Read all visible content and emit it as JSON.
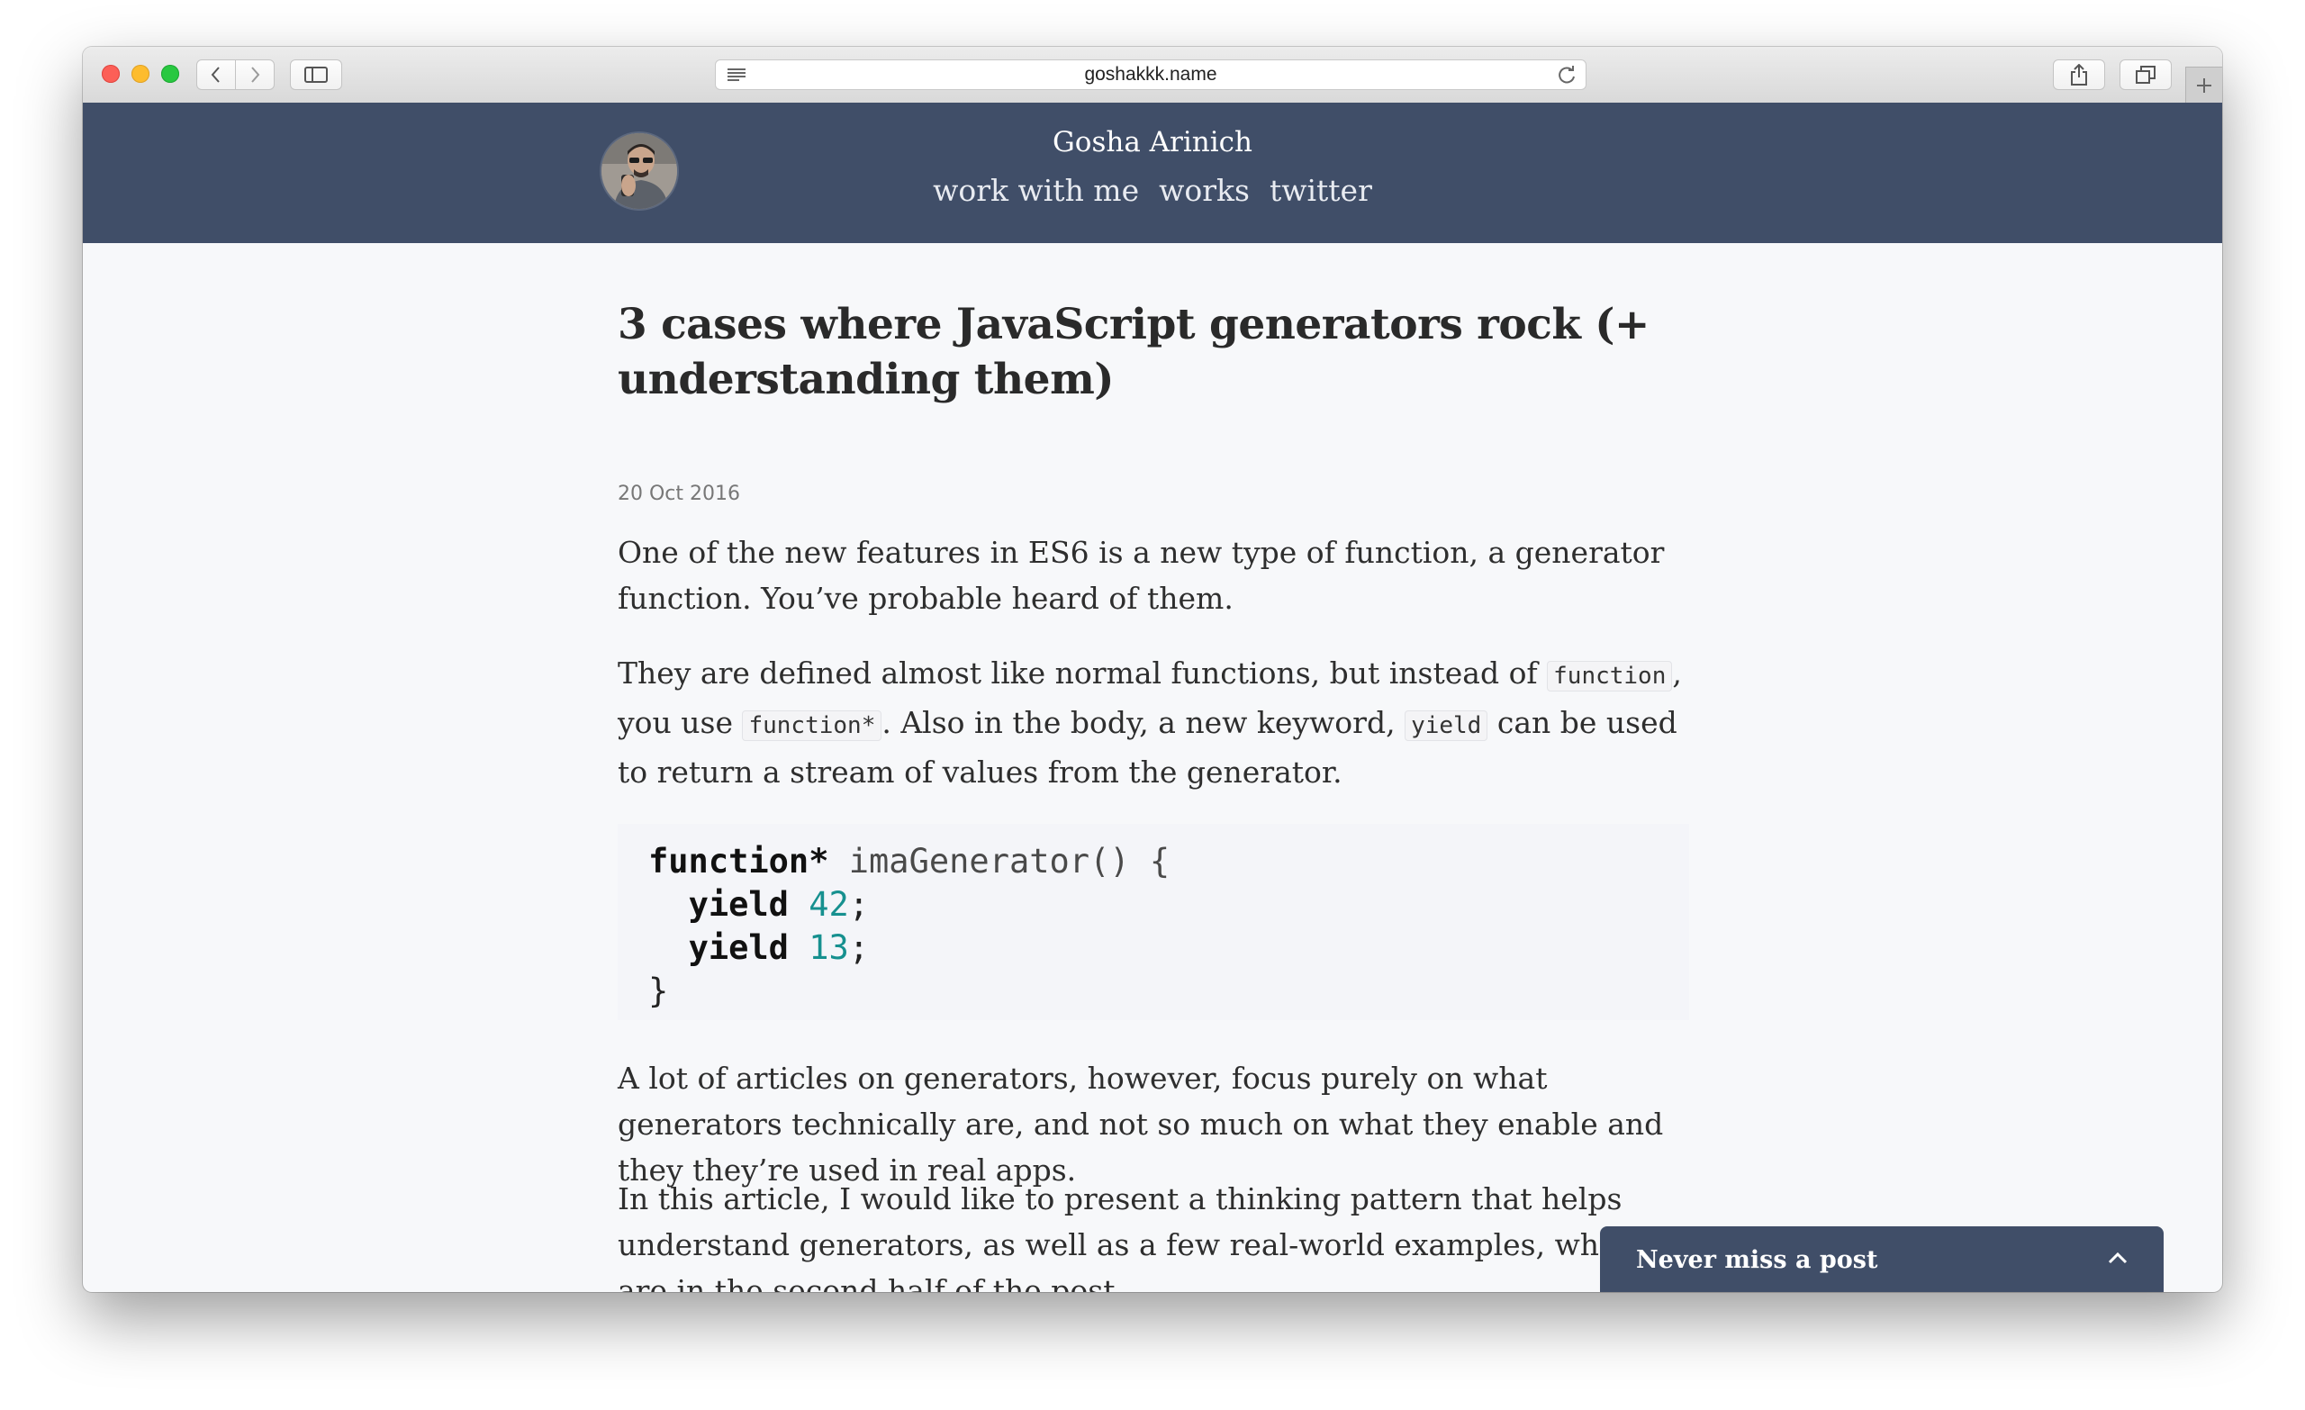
{
  "browser": {
    "url": "goshakkk.name"
  },
  "site": {
    "name": "Gosha Arinich",
    "nav": [
      {
        "label": "work with me"
      },
      {
        "label": "works"
      },
      {
        "label": "twitter"
      }
    ]
  },
  "article": {
    "title": "3 cases where JavaScript generators rock (+ understanding them)",
    "date": "20 Oct 2016",
    "p1": "One of the new features in ES6 is a new type of function, a generator function. You’ve probable heard of them.",
    "p2": {
      "t1": "They are defined almost like normal functions, but instead of ",
      "c1": "function",
      "t2": ", you use ",
      "c2": "function*",
      "t3": ". Also in the body, a new keyword, ",
      "c3": "yield",
      "t4": " can be used to return a stream of values from the generator."
    },
    "code": {
      "line1_kw": "function*",
      "line1_rest": " imaGenerator() {",
      "line2_kw": "yield",
      "line2_num": "42",
      "line3_kw": "yield",
      "line3_num": "13",
      "line4": "}"
    },
    "p3": "A lot of articles on generators, however, focus purely on what generators technically are, and not so much on what they enable and they they’re used in real apps.",
    "p4": "In this article, I would like to present a thinking pattern that helps understand generators, as well as a few real-world examples, which are in the second half of the post."
  },
  "newsletter": {
    "label": "Never miss a post"
  },
  "colors": {
    "header_bg": "#404e68",
    "page_bg": "#f7f8fa",
    "number_accent": "#16908f"
  }
}
